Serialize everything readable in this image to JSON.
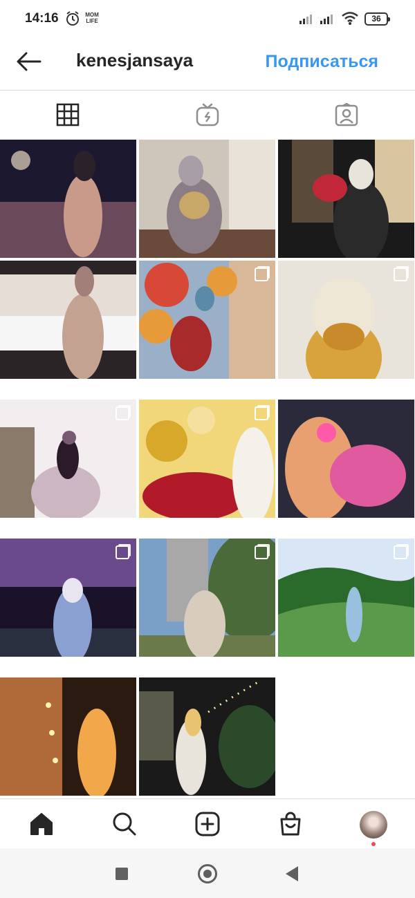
{
  "status": {
    "time": "14:16",
    "app_badge": "MOM LIFE",
    "battery": "36"
  },
  "header": {
    "username": "kenesjansaya",
    "subscribe_label": "Подписаться"
  },
  "tabs": [
    {
      "name": "grid-icon",
      "active": true
    },
    {
      "name": "igtv-icon",
      "active": false
    },
    {
      "name": "tagged-icon",
      "active": false
    }
  ],
  "posts": [
    {
      "id": 1,
      "description": "night street, woman in hijab and coat",
      "colors": [
        "#1c1830",
        "#6a4a5a",
        "#c99a8a"
      ],
      "multi": false
    },
    {
      "id": 2,
      "description": "mirror selfie, sequined gown",
      "colors": [
        "#cfc6bb",
        "#8a7d86",
        "#e8e2d8"
      ],
      "multi": false
    },
    {
      "id": 3,
      "description": "flower bouquet near boutique",
      "colors": [
        "#1a1a1a",
        "#5a4a3a",
        "#d8c6a0"
      ],
      "multi": false
    },
    {
      "id": 4,
      "description": "woman in peach dress by window",
      "colors": [
        "#2a2426",
        "#c4a292",
        "#e6ddd6"
      ],
      "multi": false
    },
    {
      "id": 5,
      "description": "balloons and roses selfie",
      "colors": [
        "#d84836",
        "#e69a3a",
        "#9ab0c8"
      ],
      "multi": true
    },
    {
      "id": 6,
      "description": "mirror selfie yellow blouse",
      "colors": [
        "#e8e4dc",
        "#d8a23c",
        "#c88a2a"
      ],
      "multi": true
    },
    {
      "id": 7,
      "description": "ball gown with floral backdrop",
      "colors": [
        "#f2eef0",
        "#cbb6c2",
        "#7a5a72"
      ],
      "multi": true
    },
    {
      "id": 8,
      "description": "gold balloons and red roses",
      "colors": [
        "#f2d67a",
        "#d8a82a",
        "#b21a2a"
      ],
      "multi": true
    },
    {
      "id": 9,
      "description": "pink roses bouquet in car",
      "colors": [
        "#2a2a3a",
        "#e8a070",
        "#e05aa0"
      ],
      "multi": false
    },
    {
      "id": 10,
      "description": "fairy lights venue",
      "colors": [
        "#1a1228",
        "#6a4a8a",
        "#d8a0d8"
      ],
      "multi": true
    },
    {
      "id": 11,
      "description": "city trees, beige outfit",
      "colors": [
        "#7aa0c8",
        "#4a6a3a",
        "#d8ccbc"
      ],
      "multi": true
    },
    {
      "id": 12,
      "description": "green mountain meadow",
      "colors": [
        "#d8e6f6",
        "#5a9a4a",
        "#2a6a2a"
      ],
      "multi": true
    },
    {
      "id": 13,
      "description": "brick wall with lights at night",
      "colors": [
        "#2a1a10",
        "#b06a3a",
        "#f2a84a"
      ],
      "multi": false
    },
    {
      "id": 14,
      "description": "terrace with string lights",
      "colors": [
        "#1a1a1a",
        "#5a5a4a",
        "#e8c470"
      ],
      "multi": false
    }
  ],
  "bottom_nav": [
    {
      "name": "home-icon"
    },
    {
      "name": "search-icon"
    },
    {
      "name": "add-post-icon"
    },
    {
      "name": "shop-icon"
    },
    {
      "name": "profile-avatar"
    }
  ]
}
